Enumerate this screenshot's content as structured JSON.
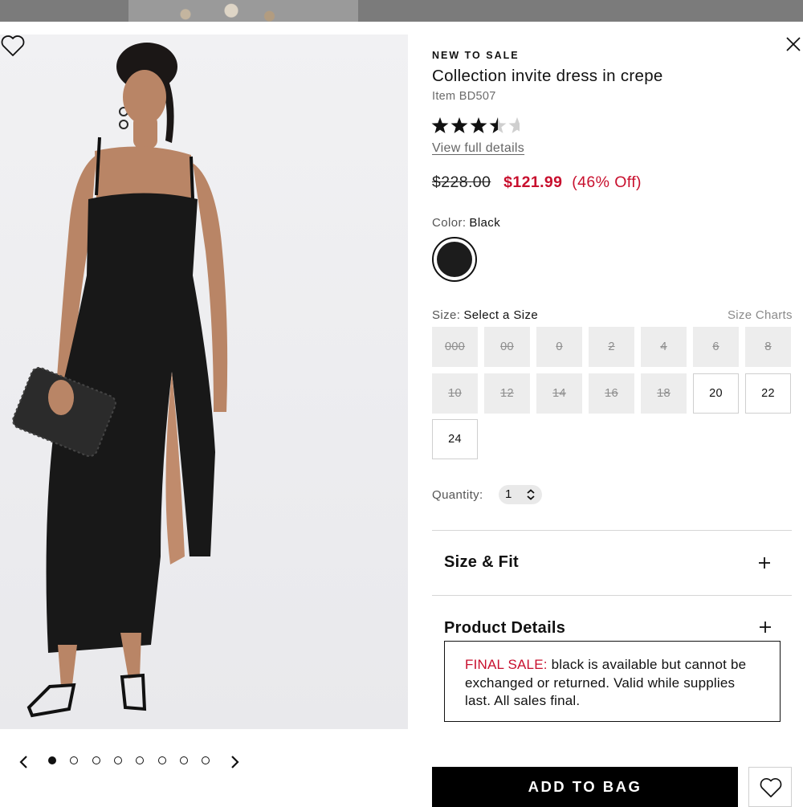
{
  "product": {
    "eyebrow": "NEW TO SALE",
    "title": "Collection invite dress in crepe",
    "item_number": "Item BD507",
    "rating": 3.5,
    "rating_max": 5,
    "view_details_label": "View full details"
  },
  "price": {
    "original": "$228.00",
    "sale": "$121.99",
    "discount": "(46% Off)"
  },
  "color": {
    "label": "Color:",
    "selected": "Black",
    "swatch_hex": "#1c1c1c"
  },
  "size": {
    "label": "Size:",
    "selected": "Select a Size",
    "charts_label": "Size Charts",
    "options": [
      {
        "label": "000",
        "available": false
      },
      {
        "label": "00",
        "available": false
      },
      {
        "label": "0",
        "available": false
      },
      {
        "label": "2",
        "available": false
      },
      {
        "label": "4",
        "available": false
      },
      {
        "label": "6",
        "available": false
      },
      {
        "label": "8",
        "available": false
      },
      {
        "label": "10",
        "available": false
      },
      {
        "label": "12",
        "available": false
      },
      {
        "label": "14",
        "available": false
      },
      {
        "label": "16",
        "available": false
      },
      {
        "label": "18",
        "available": false
      },
      {
        "label": "20",
        "available": true
      },
      {
        "label": "22",
        "available": true
      },
      {
        "label": "24",
        "available": true
      }
    ]
  },
  "quantity": {
    "label": "Quantity:",
    "value": "1"
  },
  "accordions": [
    {
      "label": "Size & Fit"
    },
    {
      "label": "Product Details"
    }
  ],
  "notice": {
    "prefix": "FINAL SALE:",
    "text": " black is available but cannot be exchanged or returned. Valid while supplies last. All sales final."
  },
  "actions": {
    "add_to_bag": "ADD TO BAG"
  },
  "carousel": {
    "total": 8,
    "active_index": 0
  },
  "colors": {
    "sale_red": "#c8102e",
    "primary_black": "#000000",
    "unavailable_gray": "#ededed"
  },
  "icons": {
    "close": "close-icon",
    "wishlist": "heart-icon",
    "prev": "chevron-left-icon",
    "next": "chevron-right-icon",
    "quantity": "chevron-up-down-icon",
    "expand": "plus-icon"
  }
}
